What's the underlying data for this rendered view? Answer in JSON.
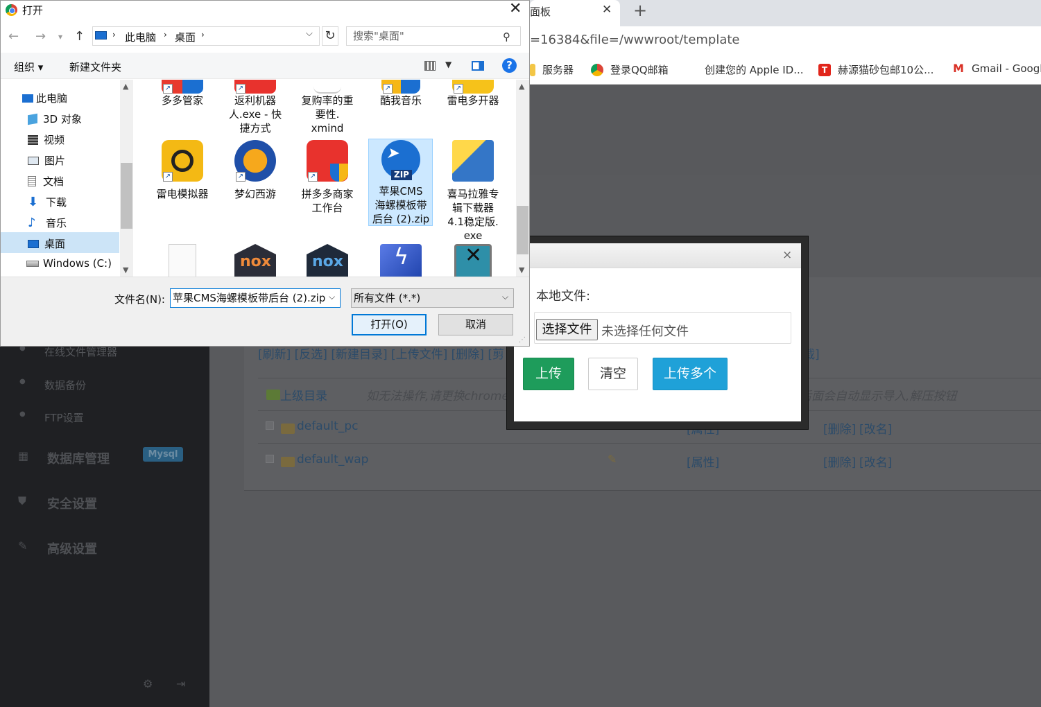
{
  "browser": {
    "tab_title": "面板",
    "url": "=16384&file=/wwwroot/template",
    "bookmarks": [
      "服务器",
      "登录QQ邮箱",
      "创建您的 Apple ID...",
      "赫源猫砂包邮10公...",
      "Gmail - Googl"
    ]
  },
  "sidebar": {
    "items": [
      "在线文件管理器",
      "数据备份",
      "FTP设置"
    ],
    "sections": [
      "数据库管理",
      "安全设置",
      "高级设置"
    ],
    "mysql_badge": "Mysql"
  },
  "file_manager": {
    "actions": "[刷新] [反选] [新建目录] [上传文件] [删除] [剪",
    "actions_tail": "载]",
    "parent_dir": "上级目录",
    "hint": "如无法操作,请更换chrome",
    "hint_tail": "后面会自动显示导入,解压按钮",
    "rows": [
      {
        "name": "default_pc",
        "attr": "[属性]",
        "del": "[删除]",
        "rename": "[改名]"
      },
      {
        "name": "default_wap",
        "attr": "[属性]",
        "del": "[删除]",
        "rename": "[改名]"
      }
    ]
  },
  "upload_dialog": {
    "close": "×",
    "local_file_label": "本地文件:",
    "choose_file": "选择文件",
    "no_file": "未选择任何文件",
    "upload": "上传",
    "clear": "清空",
    "upload_multi": "上传多个"
  },
  "open_dialog": {
    "title": "打开",
    "close": "✕",
    "breadcrumb": [
      "此电脑",
      "桌面"
    ],
    "search_placeholder": "搜索\"桌面\"",
    "organize": "组织 ▾",
    "new_folder": "新建文件夹",
    "help": "?",
    "tree": [
      "此电脑",
      "3D 对象",
      "视频",
      "图片",
      "文档",
      "下载",
      "音乐",
      "桌面",
      "Windows (C:)"
    ],
    "tiles_row1": [
      "多多管家",
      "返利机器\n人.exe - 快\n捷方式",
      "复购率的重\n要性.\nxmind",
      "酷我音乐",
      "雷电多开器"
    ],
    "tiles_row2": [
      "雷电模拟器",
      "梦幻西游",
      "拼多多商家\n工作台",
      "苹果CMS\n海螺模板带\n后台 (2).zip",
      "喜马拉雅专\n辑下载器\n4.1稳定版.\nexe"
    ],
    "zip_badge": "ZIP",
    "nox_text": "nox",
    "filename_label": "文件名(N):",
    "filename_value": "苹果CMS海螺模板带后台 (2).zip",
    "filetype": "所有文件 (*.*)",
    "open_button": "打开(O)",
    "cancel_button": "取消"
  }
}
